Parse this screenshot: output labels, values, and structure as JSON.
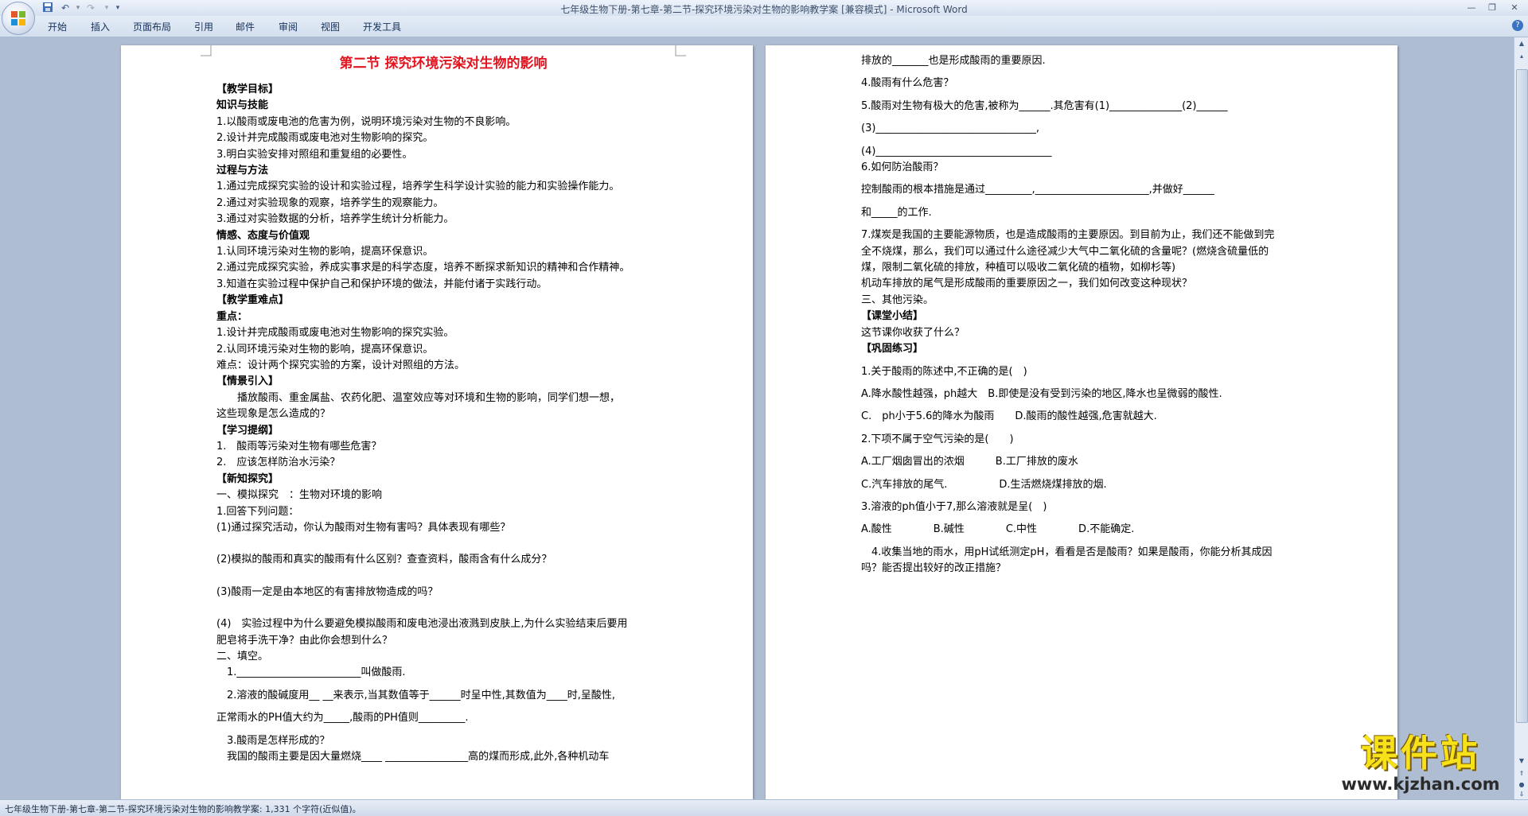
{
  "window": {
    "title": "七年级生物下册-第七章-第二节-探究环境污染对生物的影响教学案 [兼容模式] - Microsoft Word"
  },
  "ribbon": {
    "tabs": [
      {
        "label": "开始"
      },
      {
        "label": "插入"
      },
      {
        "label": "页面布局"
      },
      {
        "label": "引用"
      },
      {
        "label": "邮件"
      },
      {
        "label": "审阅"
      },
      {
        "label": "视图"
      },
      {
        "label": "开发工具"
      }
    ]
  },
  "page_left": {
    "title": "第二节  探究环境污染对生物的影响",
    "lines": [
      "【教学目标】",
      "知识与技能",
      "1.以酸雨或废电池的危害为例，说明环境污染对生物的不良影响。",
      "2.设计并完成酸雨或废电池对生物影响的探究。",
      "3.明白实验安排对照组和重复组的必要性。",
      "过程与方法",
      "1.通过完成探究实验的设计和实验过程，培养学生科学设计实验的能力和实验操作能力。",
      "2.通过对实验现象的观察，培养学生的观察能力。",
      "3.通过对实验数据的分析，培养学生统计分析能力。",
      "情感、态度与价值观",
      "1.认同环境污染对生物的影响，提高环保意识。",
      "2.通过完成探究实验，养成实事求是的科学态度，培养不断探求新知识的精神和合作精神。",
      "3.知道在实验过程中保护自己和保护环境的做法，并能付诸于实践行动。",
      "【教学重难点】",
      "重点：",
      "1.设计并完成酸雨或废电池对生物影响的探究实验。",
      "2.认同环境污染对生物的影响，提高环保意识。",
      "难点：设计两个探究实验的方案，设计对照组的方法。",
      "【情景引入】",
      "　　播放酸雨、重金属盐、农药化肥、温室效应等对环境和生物的影响，同学们想一想，",
      "这些现象是怎么造成的？",
      "【学习提纲】",
      "1.　酸雨等污染对生物有哪些危害？",
      "2.　应该怎样防治水污染？",
      "【新知探究】",
      "一、模拟探究　：生物对环境的影响",
      "1.回答下列问题：",
      "(1)通过探究活动，你认为酸雨对生物有害吗？具体表现有哪些？",
      "",
      "(2)模拟的酸雨和真实的酸雨有什么区别？查查资料，酸雨含有什么成分？",
      "",
      "(3)酸雨一定是由本地区的有害排放物造成的吗？",
      "",
      "(4)　实验过程中为什么要避免模拟酸雨和废电池浸出液溅到皮肤上,为什么实验结束后要用",
      "肥皂将手洗干净？由此你会想到什么？",
      "二、填空。",
      "　1.________________________叫做酸雨.",
      "　2.溶液的酸碱度用__ __来表示,当其数值等于______时呈中性,其数值为____时,呈酸性,",
      "正常雨水的PH值大约为_____,酸雨的PH值则_________.",
      "　3.酸雨是怎样形成的？",
      "　我国的酸雨主要是因大量燃烧____ ________________高的煤而形成,此外,各种机动车"
    ]
  },
  "page_right": {
    "lines": [
      "排放的_______也是形成酸雨的重要原因.",
      "4.酸雨有什么危害？",
      "5.酸雨对生物有极大的危害,被称为______.其危害有(1)______________(2)______",
      "(3)_______________________________,",
      "(4)__________________________________",
      "6.如何防治酸雨？",
      "控制酸雨的根本措施是通过_________,______________________,并做好______",
      "和_____的工作.",
      "7.煤炭是我国的主要能源物质，也是造成酸雨的主要原因。到目前为止，我们还不能做到完",
      "全不烧煤，那么，我们可以通过什么途径减少大气中二氧化硫的含量呢？(燃烧含硫量低的",
      "煤，限制二氧化硫的排放，种植可以吸收二氧化硫的植物，如柳杉等)",
      "机动车排放的尾气是形成酸雨的重要原因之一，我们如何改变这种现状？",
      "三、其他污染。",
      "【课堂小结】",
      "这节课你收获了什么？",
      "【巩固练习】",
      "1.关于酸雨的陈述中,不正确的是(　)",
      "A.降水酸性越强，ph越大　B.即使是没有受到污染的地区,降水也呈微弱的酸性.",
      "C.　ph小于5.6的降水为酸雨　　D.酸雨的酸性越强,危害就越大.",
      "2.下项不属于空气污染的是(　　)",
      "A.工厂烟囱冒出的浓烟　　　B.工厂排放的废水",
      "C.汽车排放的尾气.　　　　　D.生活燃烧煤排放的烟.",
      "3.溶液的ph值小于7,那么溶液就是呈(　)",
      "A.酸性　　　　B.碱性　　　　C.中性　　　　D.不能确定.",
      "　4.收集当地的雨水，用pH试纸测定pH，看看是否是酸雨？如果是酸雨，你能分析其成因",
      "吗？能否提出较好的改正措施？",
      ""
    ]
  },
  "status_bar": {
    "text": "七年级生物下册-第七章-第二节-探究环境污染对生物的影响教学案: 1,331 个字符(近似值)。"
  },
  "watermark": {
    "title": "课件站",
    "url": "www.kjzhan.com"
  },
  "icons": {
    "office_button": "office-logo-icon",
    "save": "save-icon",
    "undo": "undo-icon",
    "redo": "redo-icon",
    "help": "help-icon"
  }
}
